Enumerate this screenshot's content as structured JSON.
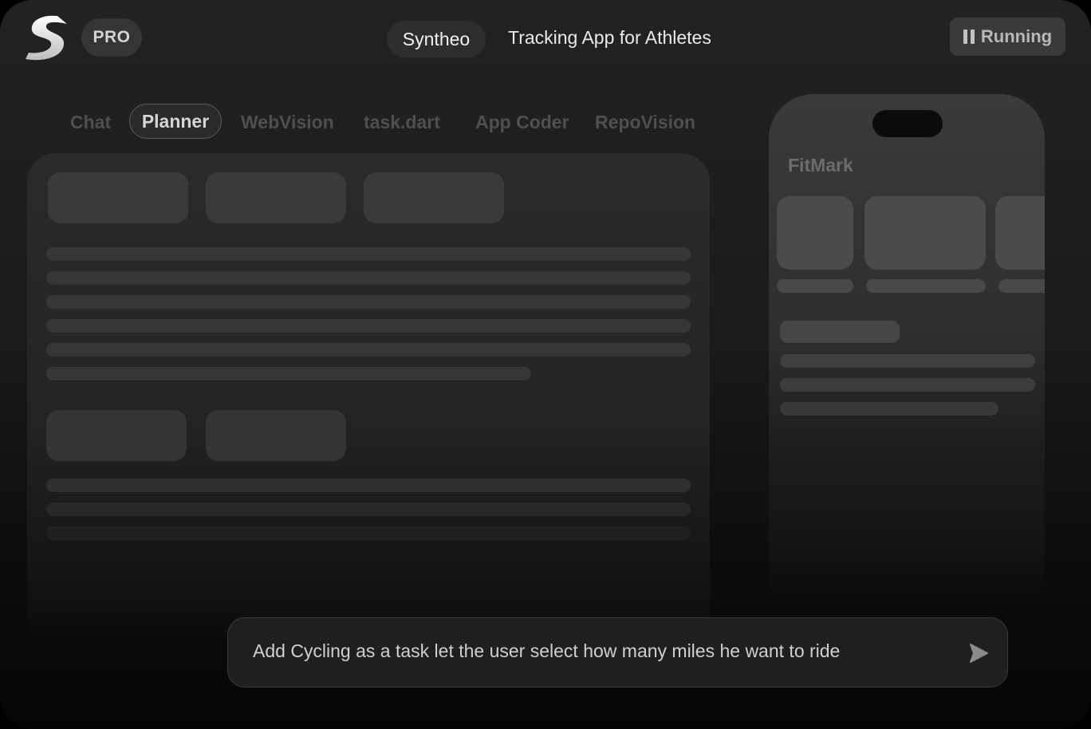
{
  "header": {
    "logo_icon": "syntheo-s-logo-icon",
    "plan_badge": "PRO",
    "project_name": "Syntheo",
    "project_description": "Tracking App for Athletes",
    "status_button": {
      "label": "Running",
      "icon": "pause-icon"
    }
  },
  "tabs": [
    {
      "label": "Chat",
      "active": false
    },
    {
      "label": "Planner",
      "active": true
    },
    {
      "label": "WebVision",
      "active": false
    },
    {
      "label": "task.dart",
      "active": false
    },
    {
      "label": "App Coder",
      "active": false
    },
    {
      "label": "RepoVision",
      "active": false
    }
  ],
  "preview": {
    "app_title": "FitMark"
  },
  "prompt": {
    "value": "Add Cycling as a task let the user select how many miles he want to ride",
    "send_icon": "send-arrow-icon"
  },
  "colors": {
    "background": "#000000",
    "panel": "#2b2b2c",
    "skeleton": "#363637",
    "accent_text": "#eaeaea"
  }
}
